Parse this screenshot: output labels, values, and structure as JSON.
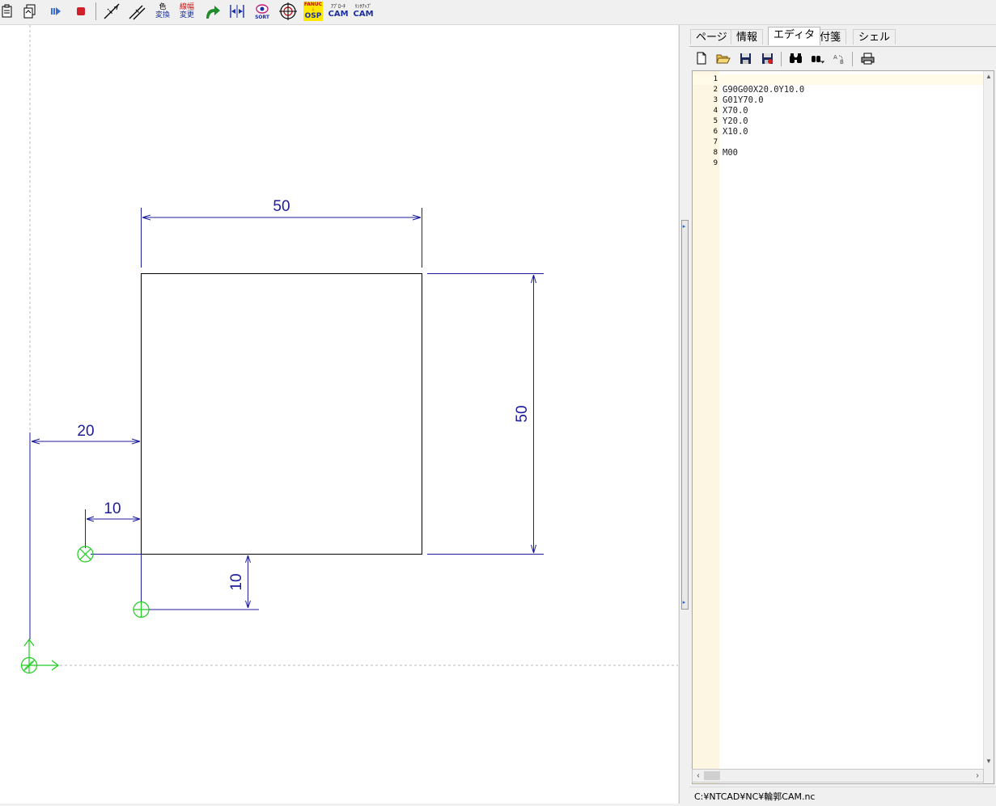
{
  "toolbar": {
    "color_change_label_1": "色",
    "color_change_label_2": "変換",
    "line_width_label_1": "線幅",
    "line_width_label_2": "変更",
    "sort_label": "SORT",
    "fanuc_label": "FANUC",
    "osp_label": "OSP",
    "approach_cam_kana": "ｱﾌﾟﾛｰﾁ",
    "approach_cam_label": "CAM",
    "link_cam_kana": "ﾘﾝｸｱｯﾌﾟ",
    "link_cam_label": "CAM"
  },
  "canvas": {
    "dimensions": {
      "top_width": "50",
      "right_height": "50",
      "left_offset": "20",
      "small_offset_x": "10",
      "small_offset_y": "10"
    },
    "colors": {
      "dimension": "#1c1c9c",
      "geometry": "#000000",
      "marker": "#22cc22",
      "axis": "#b0b0b0"
    }
  },
  "panel": {
    "tabs": [
      {
        "label": "ページ",
        "active": false
      },
      {
        "label": "情報",
        "active": false
      },
      {
        "label": "エディタ",
        "active": true
      },
      {
        "label": "付箋",
        "active": false
      },
      {
        "label": "シェル",
        "active": false
      }
    ],
    "editor_lines": [
      {
        "num": "1",
        "code": ""
      },
      {
        "num": "2",
        "code": "G90G00X20.0Y10.0"
      },
      {
        "num": "3",
        "code": "G01Y70.0"
      },
      {
        "num": "4",
        "code": "X70.0"
      },
      {
        "num": "5",
        "code": "Y20.0"
      },
      {
        "num": "6",
        "code": "X10.0"
      },
      {
        "num": "7",
        "code": ""
      },
      {
        "num": "8",
        "code": "M00"
      },
      {
        "num": "9",
        "code": ""
      }
    ],
    "status_path": "C:¥NTCAD¥NC¥輪郭CAM.nc"
  }
}
